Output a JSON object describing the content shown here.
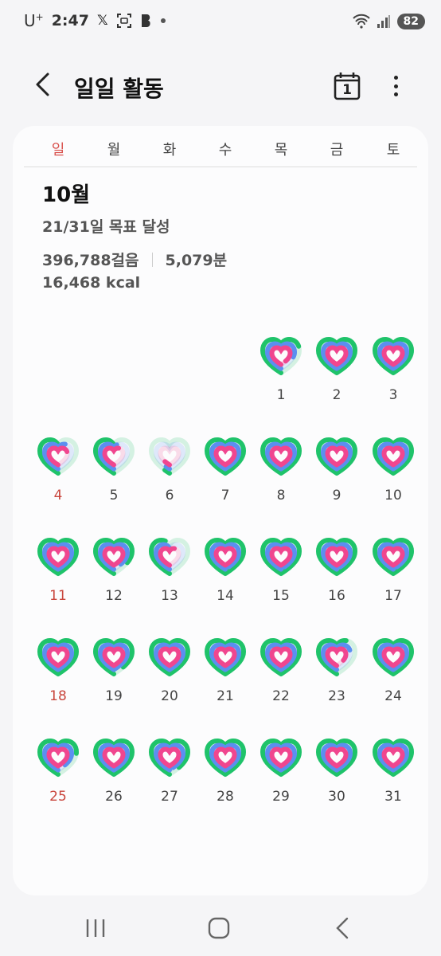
{
  "status_bar": {
    "carrier": "U",
    "carrier_sup": "+",
    "time": "2:47",
    "battery": "82"
  },
  "header": {
    "title": "일일 활동",
    "calendar_day": "1"
  },
  "weekdays": [
    "일",
    "월",
    "화",
    "수",
    "목",
    "금",
    "토"
  ],
  "summary": {
    "month": "10월",
    "goal_text": "21/31일 목표 달성",
    "steps": "396,788걸음",
    "minutes": "5,079분",
    "kcal": "16,468 kcal"
  },
  "colors": {
    "green": "#1fc36a",
    "blue": "#5b8ff0",
    "pink": "#f0468f",
    "sunday": "#c9463d"
  },
  "calendar": {
    "first_weekday": 3,
    "days": [
      {
        "day": "1",
        "steps": 0.7,
        "active": 0.8,
        "cal": 0.9
      },
      {
        "day": "2",
        "steps": 1,
        "active": 1,
        "cal": 1
      },
      {
        "day": "3",
        "steps": 1,
        "active": 1,
        "cal": 1
      },
      {
        "day": "4",
        "steps": 0.5,
        "active": 0.6,
        "cal": 0.7
      },
      {
        "day": "5",
        "steps": 0.5,
        "active": 0.55,
        "cal": 0.6
      },
      {
        "day": "6",
        "steps": 0.05,
        "active": 0.05,
        "cal": 0.1
      },
      {
        "day": "7",
        "steps": 1,
        "active": 1,
        "cal": 1
      },
      {
        "day": "8",
        "steps": 1,
        "active": 1,
        "cal": 1
      },
      {
        "day": "9",
        "steps": 1,
        "active": 1,
        "cal": 1
      },
      {
        "day": "10",
        "steps": 1,
        "active": 1,
        "cal": 1
      },
      {
        "day": "11",
        "steps": 1,
        "active": 1,
        "cal": 1
      },
      {
        "day": "12",
        "steps": 0.85,
        "active": 0.9,
        "cal": 1
      },
      {
        "day": "13",
        "steps": 0.45,
        "active": 0.5,
        "cal": 0.6
      },
      {
        "day": "14",
        "steps": 1,
        "active": 0.95,
        "cal": 1
      },
      {
        "day": "15",
        "steps": 1,
        "active": 0.95,
        "cal": 1
      },
      {
        "day": "16",
        "steps": 1,
        "active": 0.95,
        "cal": 1
      },
      {
        "day": "17",
        "steps": 1,
        "active": 0.95,
        "cal": 1
      },
      {
        "day": "18",
        "steps": 1,
        "active": 1,
        "cal": 1
      },
      {
        "day": "19",
        "steps": 0.9,
        "active": 1,
        "cal": 1
      },
      {
        "day": "20",
        "steps": 1,
        "active": 1,
        "cal": 1
      },
      {
        "day": "21",
        "steps": 1,
        "active": 1,
        "cal": 1
      },
      {
        "day": "22",
        "steps": 1,
        "active": 1,
        "cal": 1
      },
      {
        "day": "23",
        "steps": 0.6,
        "active": 0.7,
        "cal": 0.85
      },
      {
        "day": "24",
        "steps": 1,
        "active": 1,
        "cal": 1
      },
      {
        "day": "25",
        "steps": 0.75,
        "active": 0.9,
        "cal": 1
      },
      {
        "day": "26",
        "steps": 1,
        "active": 1,
        "cal": 1
      },
      {
        "day": "27",
        "steps": 0.9,
        "active": 0.95,
        "cal": 1
      },
      {
        "day": "28",
        "steps": 1,
        "active": 1,
        "cal": 1
      },
      {
        "day": "29",
        "steps": 1,
        "active": 1,
        "cal": 1
      },
      {
        "day": "30",
        "steps": 1,
        "active": 1,
        "cal": 1
      },
      {
        "day": "31",
        "steps": 1,
        "active": 1,
        "cal": 1
      }
    ]
  },
  "nav_bar": {
    "icons": [
      "recent-apps-icon",
      "home-icon",
      "back-icon"
    ]
  }
}
